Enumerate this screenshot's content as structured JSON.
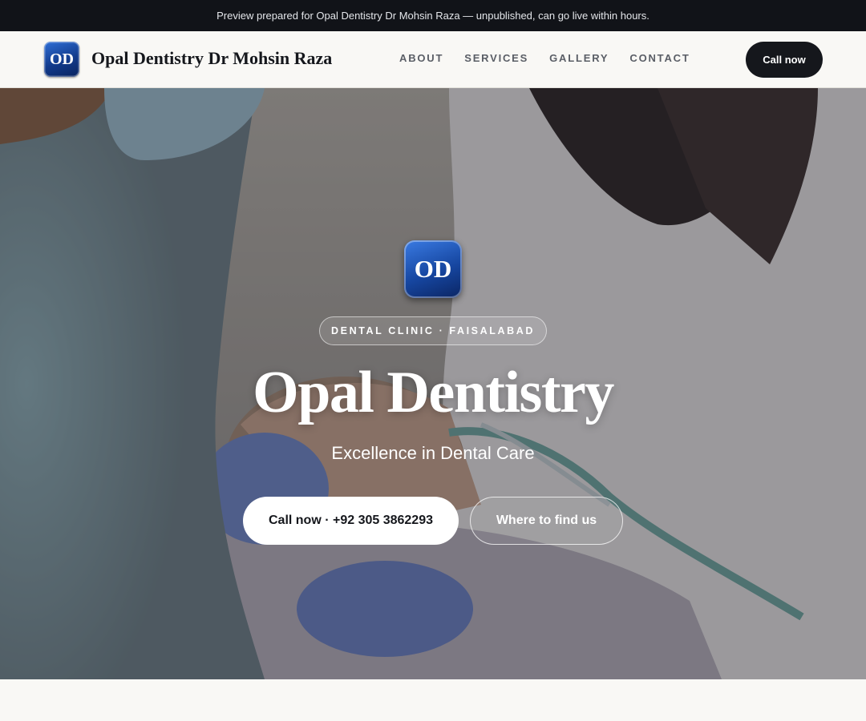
{
  "preview_bar": {
    "text": "Preview prepared for Opal Dentistry Dr Mohsin Raza — unpublished, can go live within hours."
  },
  "header": {
    "logo_text": "OD",
    "brand_name": "Opal Dentistry Dr Mohsin Raza",
    "nav": [
      {
        "label": "ABOUT"
      },
      {
        "label": "SERVICES"
      },
      {
        "label": "GALLERY"
      },
      {
        "label": "CONTACT"
      }
    ],
    "cta_label": "Call now"
  },
  "hero": {
    "logo_text": "OD",
    "eyebrow": "DENTAL CLINIC · FAISALABAD",
    "title": "Opal Dentistry",
    "subtitle": "Excellence in Dental Care",
    "primary_button": "Call now · +92 305 3862293",
    "secondary_button": "Where to find us",
    "background_icon": "dental-treatment-photo"
  },
  "colors": {
    "topbar_bg": "#111318",
    "header_bg": "#f9f8f5",
    "dark_button": "#15171c",
    "logo_blue": "#1646a0"
  }
}
